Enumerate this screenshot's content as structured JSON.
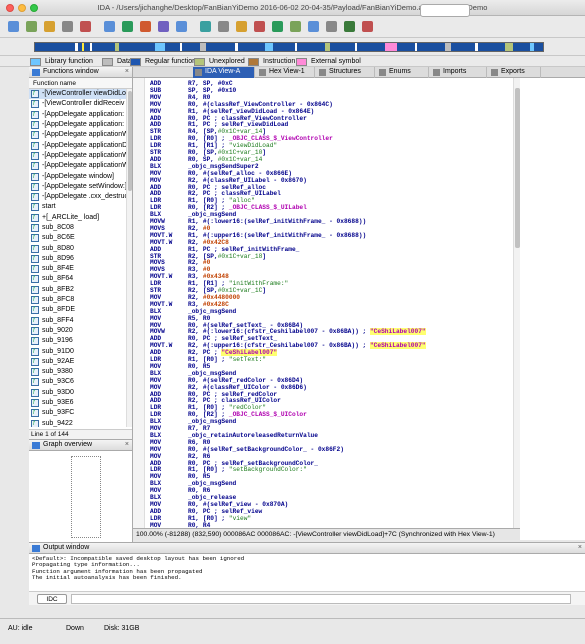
{
  "window": {
    "title": "IDA - /Users/jichanghe/Desktop/FanBianYiDemo 2016-06-02 20-04-35/Payload/FanBianYiDemo.app/FanBianYiDemo"
  },
  "legend": [
    {
      "label": "Library function",
      "color": "#6ec6ff"
    },
    {
      "label": "Data",
      "color": "#bdbdbd"
    },
    {
      "label": "Regular function",
      "color": "#1e56b0"
    },
    {
      "label": "Unexplored",
      "color": "#b4c47a"
    },
    {
      "label": "Instruction",
      "color": "#b07838"
    },
    {
      "label": "External symbol",
      "color": "#ff8ad8"
    }
  ],
  "functions_panel": {
    "title": "Functions window",
    "column": "Function name",
    "line_info": "Line 1 of 144",
    "items": [
      "-[ViewController viewDidLoad]",
      "-[ViewController didReceiv",
      "-[AppDelegate application:",
      "-[AppDelegate application:",
      "-[AppDelegate applicationW",
      "-[AppDelegate applicationD",
      "-[AppDelegate applicationW",
      "-[AppDelegate applicationW",
      "-[AppDelegate window]",
      "-[AppDelegate setWindow:]",
      "-[AppDelegate .cxx_destruc",
      "start",
      "+[_ARCLite_ load]",
      "sub_8C08",
      "sub_8C6E",
      "sub_8D80",
      "sub_8D96",
      "sub_8F4E",
      "sub_8F64",
      "sub_8FB2",
      "sub_8FC8",
      "sub_8FDE",
      "sub_8FF4",
      "sub_9020",
      "sub_9196",
      "sub_91D0",
      "sub_92AE",
      "sub_9380",
      "sub_93C6",
      "sub_93D0",
      "sub_93E6",
      "sub_93FC",
      "sub_9422"
    ]
  },
  "graph_panel": {
    "title": "Graph overview"
  },
  "tabs": [
    "IDA View-A",
    "Hex View-1",
    "Structures",
    "Enums",
    "Imports",
    "Exports"
  ],
  "code": [
    [
      [
        "m",
        "ADD"
      ],
      [
        "o",
        "R7, SP, #0xC"
      ]
    ],
    [
      [
        "m",
        "SUB"
      ],
      [
        "o",
        "SP, SP, #0x10"
      ]
    ],
    [
      [
        "m",
        "MOV"
      ],
      [
        "o",
        "R4, R0"
      ]
    ],
    [
      [
        "m",
        "MOV"
      ],
      [
        "o",
        "R0, #(classRef_ViewController - 0x864C)"
      ]
    ],
    [
      [
        "m",
        "MOV"
      ],
      [
        "o",
        "R1, #(selRef_viewDidLoad - 0x864E)"
      ]
    ],
    [
      [
        "m",
        "ADD"
      ],
      [
        "o",
        "R0, PC ; classRef_ViewController"
      ]
    ],
    [
      [
        "m",
        "ADD"
      ],
      [
        "o",
        "R1, PC ; selRef_viewDidLoad"
      ]
    ],
    [
      [
        "m",
        "STR"
      ],
      [
        "o",
        "R4, [SP,"
      ],
      [
        "g",
        "#0x1C+var_14"
      ],
      [
        "o",
        "]"
      ]
    ],
    [
      [
        "m",
        "LDR"
      ],
      [
        "o",
        "R0, [R0] ; "
      ],
      [
        "p",
        "_OBJC_CLASS_$_ViewController"
      ]
    ],
    [
      [
        "m",
        "LDR"
      ],
      [
        "o",
        "R1, [R1] ; "
      ],
      [
        "g",
        "\"viewDidLoad\""
      ]
    ],
    [
      [
        "m",
        "STR"
      ],
      [
        "o",
        "R0, [SP,"
      ],
      [
        "g",
        "#0x1C+var_10"
      ],
      [
        "o",
        "]"
      ]
    ],
    [
      [
        "m",
        "ADD"
      ],
      [
        "o",
        "R0, SP, "
      ],
      [
        "g",
        "#0x1C+var_14"
      ]
    ],
    [
      [
        "m",
        "BLX"
      ],
      [
        "o",
        "_objc_msgSendSuper2"
      ]
    ],
    [
      [
        "m",
        "MOV"
      ],
      [
        "o",
        "R0, #(selRef_alloc - 0x866E)"
      ]
    ],
    [
      [
        "m",
        "MOV"
      ],
      [
        "o",
        "R2, #(classRef_UILabel - 0x8670)"
      ]
    ],
    [
      [
        "m",
        "ADD"
      ],
      [
        "o",
        "R0, PC ; selRef_alloc"
      ]
    ],
    [
      [
        "m",
        "ADD"
      ],
      [
        "o",
        "R2, PC ; classRef_UILabel"
      ]
    ],
    [
      [
        "m",
        "LDR"
      ],
      [
        "o",
        "R1, [R0] ; "
      ],
      [
        "g",
        "\"alloc\""
      ]
    ],
    [
      [
        "m",
        "LDR"
      ],
      [
        "o",
        "R0, [R2] ; "
      ],
      [
        "p",
        "_OBJC_CLASS_$_UILabel"
      ]
    ],
    [
      [
        "m",
        "BLX"
      ],
      [
        "o",
        "_objc_msgSend"
      ]
    ],
    [
      [
        "m",
        "MOVW"
      ],
      [
        "o",
        "R1, #(:lower16:(selRef_initWithFrame_ - 0x8688))"
      ]
    ],
    [
      [
        "m",
        "MOVS"
      ],
      [
        "o",
        "R2, "
      ],
      [
        "r",
        "#0"
      ]
    ],
    [
      [
        "m",
        "MOVT.W"
      ],
      [
        "o",
        "R1, #(:upper16:(selRef_initWithFrame_ - 0x8688))"
      ]
    ],
    [
      [
        "m",
        "MOVT.W"
      ],
      [
        "o",
        "R2, "
      ],
      [
        "r",
        "#0x42C8"
      ]
    ],
    [
      [
        "m",
        "ADD"
      ],
      [
        "o",
        "R1, PC ; selRef_initWithFrame_"
      ]
    ],
    [
      [
        "m",
        "STR"
      ],
      [
        "o",
        "R2, [SP,"
      ],
      [
        "g",
        "#0x1C+var_18"
      ],
      [
        "o",
        "]"
      ]
    ],
    [
      [
        "m",
        "MOVS"
      ],
      [
        "o",
        "R2, "
      ],
      [
        "r",
        "#0"
      ]
    ],
    [
      [
        "m",
        "MOVS"
      ],
      [
        "o",
        "R3, "
      ],
      [
        "r",
        "#0"
      ]
    ],
    [
      [
        "m",
        "MOVT.W"
      ],
      [
        "o",
        "R3, "
      ],
      [
        "r",
        "#0x4348"
      ]
    ],
    [
      [
        "m",
        "LDR"
      ],
      [
        "o",
        "R1, [R1] ; "
      ],
      [
        "g",
        "\"initWithFrame:\""
      ]
    ],
    [
      [
        "m",
        "STR"
      ],
      [
        "o",
        "R2, [SP,"
      ],
      [
        "g",
        "#0x1C+var_1C"
      ],
      [
        "o",
        "]"
      ]
    ],
    [
      [
        "m",
        "MOV"
      ],
      [
        "o",
        "R2, "
      ],
      [
        "r",
        "#0x4480000"
      ]
    ],
    [
      [
        "m",
        "MOVT.W"
      ],
      [
        "o",
        "R3, "
      ],
      [
        "r",
        "#0x428C"
      ]
    ],
    [
      [
        "m",
        "BLX"
      ],
      [
        "o",
        "_objc_msgSend"
      ]
    ],
    [
      [
        "m",
        "MOV"
      ],
      [
        "o",
        "R5, R0"
      ]
    ],
    [
      [
        "m",
        "MOV"
      ],
      [
        "o",
        "R0, #(selRef_setText_ - 0x86B4)"
      ]
    ],
    [
      [
        "m",
        "MOVW"
      ],
      [
        "o",
        "R2, #(:lower16:(cfstr_Ceshilabel007 - 0x86BA)) ; "
      ],
      [
        "y",
        "\"CeShiLabel007\""
      ]
    ],
    [
      [
        "m",
        "ADD"
      ],
      [
        "o",
        "R0, PC ; selRef_setText_"
      ]
    ],
    [
      [
        "m",
        "MOVT.W"
      ],
      [
        "o",
        "R2, #(:upper16:(cfstr_Ceshilabel007 - 0x86BA)) ; "
      ],
      [
        "y",
        "\"CeShiLabel007\""
      ]
    ],
    [
      [
        "m",
        "ADD"
      ],
      [
        "o",
        "R2, PC ; "
      ],
      [
        "y",
        "\"CeShiLabel007\""
      ]
    ],
    [
      [
        "m",
        "LDR"
      ],
      [
        "o",
        "R1, [R0] ; "
      ],
      [
        "g",
        "\"setText:\""
      ]
    ],
    [
      [
        "m",
        "MOV"
      ],
      [
        "o",
        "R0, R5"
      ]
    ],
    [
      [
        "m",
        "BLX"
      ],
      [
        "o",
        "_objc_msgSend"
      ]
    ],
    [
      [
        "m",
        "MOV"
      ],
      [
        "o",
        "R0, #(selRef_redColor - 0x86D4)"
      ]
    ],
    [
      [
        "m",
        "MOV"
      ],
      [
        "o",
        "R2, #(classRef_UIColor - 0x86D6)"
      ]
    ],
    [
      [
        "m",
        "ADD"
      ],
      [
        "o",
        "R0, PC ; selRef_redColor"
      ]
    ],
    [
      [
        "m",
        "ADD"
      ],
      [
        "o",
        "R2, PC ; classRef_UIColor"
      ]
    ],
    [
      [
        "m",
        "LDR"
      ],
      [
        "o",
        "R1, [R0] ; "
      ],
      [
        "g",
        "\"redColor\""
      ]
    ],
    [
      [
        "m",
        "LDR"
      ],
      [
        "o",
        "R0, [R2] ; "
      ],
      [
        "p",
        "_OBJC_CLASS_$_UIColor"
      ]
    ],
    [
      [
        "m",
        "BLX"
      ],
      [
        "o",
        "_objc_msgSend"
      ]
    ],
    [
      [
        "m",
        "MOV"
      ],
      [
        "o",
        "R7, R7"
      ]
    ],
    [
      [
        "m",
        "BLX"
      ],
      [
        "o",
        "_objc_retainAutoreleasedReturnValue"
      ]
    ],
    [
      [
        "m",
        "MOV"
      ],
      [
        "o",
        "R6, R0"
      ]
    ],
    [
      [
        "m",
        "MOV"
      ],
      [
        "o",
        "R0, #(selRef_setBackgroundColor_ - 0x86F2)"
      ]
    ],
    [
      [
        "m",
        "MOV"
      ],
      [
        "o",
        "R2, R6"
      ]
    ],
    [
      [
        "m",
        "ADD"
      ],
      [
        "o",
        "R0, PC ; selRef_setBackgroundColor_"
      ]
    ],
    [
      [
        "m",
        "LDR"
      ],
      [
        "o",
        "R1, [R0] ; "
      ],
      [
        "g",
        "\"setBackgroundColor:\""
      ]
    ],
    [
      [
        "m",
        "MOV"
      ],
      [
        "o",
        "R0, R5"
      ]
    ],
    [
      [
        "m",
        "BLX"
      ],
      [
        "o",
        "_objc_msgSend"
      ]
    ],
    [
      [
        "m",
        "MOV"
      ],
      [
        "o",
        "R0, R6"
      ]
    ],
    [
      [
        "m",
        "BLX"
      ],
      [
        "o",
        "_objc_release"
      ]
    ],
    [
      [
        "m",
        "MOV"
      ],
      [
        "o",
        "R0, #(selRef_view - 0x870A)"
      ]
    ],
    [
      [
        "m",
        "ADD"
      ],
      [
        "o",
        "R0, PC ; selRef_view"
      ]
    ],
    [
      [
        "m",
        "LDR"
      ],
      [
        "o",
        "R1, [R0] ; "
      ],
      [
        "g",
        "\"view\""
      ]
    ],
    [
      [
        "m",
        "MOV"
      ],
      [
        "o",
        "R0, R4"
      ]
    ]
  ],
  "status_line": "100.00% (-81288) (832,590) 000086AC 000086AC: -[ViewController viewDidLoad]+7C (Synchronized with Hex View-1)",
  "output": {
    "title": "Output window",
    "lines": [
      "<Default>: Incompatible saved desktop layout has been ignored",
      "Propagating type information...",
      "Function argument information has been propagated",
      "The initial autoanalysis has been finished."
    ],
    "idc_label": "IDC"
  },
  "bottom_status": {
    "au": "AU:  idle",
    "dir": "Down",
    "disk": "Disk: 31GB"
  }
}
